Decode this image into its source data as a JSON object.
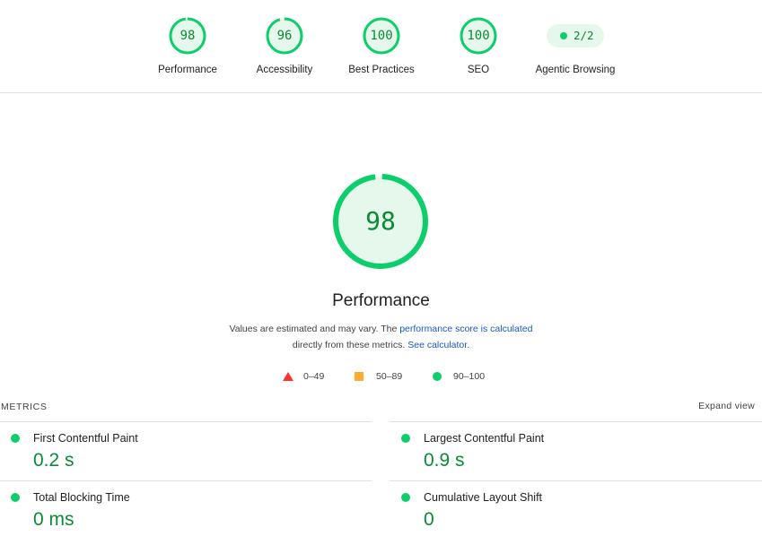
{
  "top_gauges": [
    {
      "score": "98",
      "label": "Performance"
    },
    {
      "score": "96",
      "label": "Accessibility"
    },
    {
      "score": "100",
      "label": "Best Practices"
    },
    {
      "score": "100",
      "label": "SEO"
    }
  ],
  "agentic": {
    "value": "2/2",
    "label": "Agentic Browsing"
  },
  "main": {
    "score": "98",
    "title": "Performance",
    "desc_line1_pre": "Values are estimated and may vary. The ",
    "desc_link1": "performance score is calculated",
    "desc_line2_pre": "directly from these metrics. ",
    "desc_link2": "See calculator.",
    "legend": {
      "fail": "0–49",
      "average": "50–89",
      "pass": "90–100"
    }
  },
  "metrics": {
    "heading": "METRICS",
    "expand": "Expand view",
    "items": [
      {
        "label": "First Contentful Paint",
        "value": "0.2 s"
      },
      {
        "label": "Largest Contentful Paint",
        "value": "0.9 s"
      },
      {
        "label": "Total Blocking Time",
        "value": "0 ms"
      },
      {
        "label": "Cumulative Layout Shift",
        "value": "0"
      }
    ]
  },
  "colors": {
    "pass": "#0cce6b",
    "pass_text": "#0a8a34",
    "average": "#ffaa33",
    "fail": "#ff3333",
    "link": "#1a57c9"
  }
}
